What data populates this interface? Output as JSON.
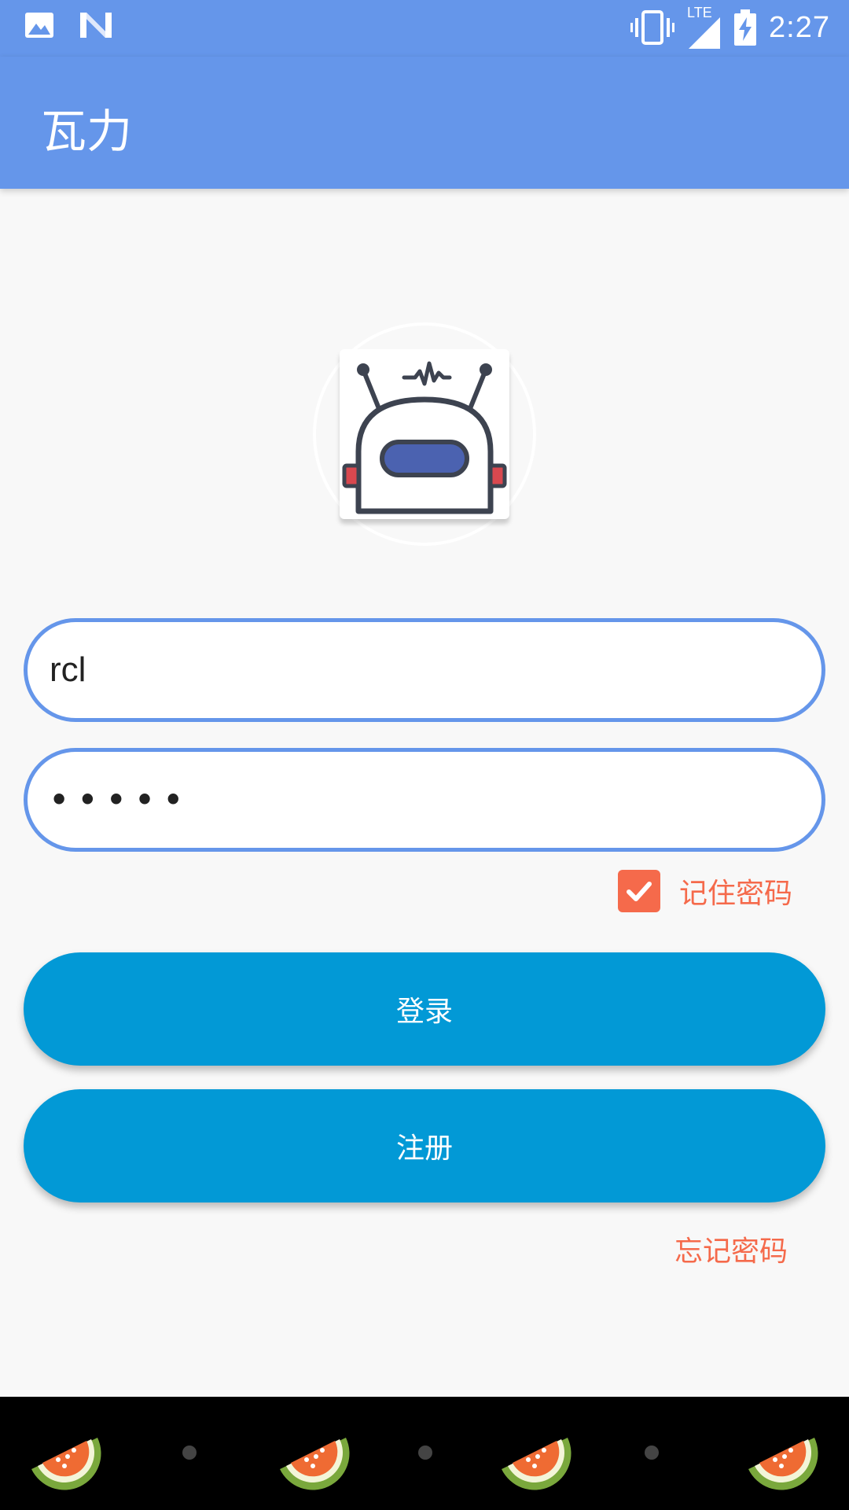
{
  "status_bar": {
    "time": "2:27",
    "network_label": "LTE",
    "icons": [
      "image-icon",
      "n-icon",
      "vibrate-icon",
      "signal-icon",
      "battery-charging-icon"
    ]
  },
  "app_bar": {
    "title": "瓦力"
  },
  "logo": {
    "icon": "robot-icon"
  },
  "form": {
    "username_value": "rcl",
    "password_mask": "•••••",
    "remember_label": "记住密码",
    "remember_checked": true,
    "login_label": "登录",
    "register_label": "注册",
    "forgot_label": "忘记密码"
  },
  "bottom_strip": {
    "icons": [
      "watermelon-icon",
      "watermelon-icon",
      "watermelon-icon",
      "watermelon-icon"
    ]
  },
  "colors": {
    "primary": "#6596ea",
    "button": "#0299d6",
    "accent": "#f56a4b",
    "background": "#f8f8f8"
  }
}
